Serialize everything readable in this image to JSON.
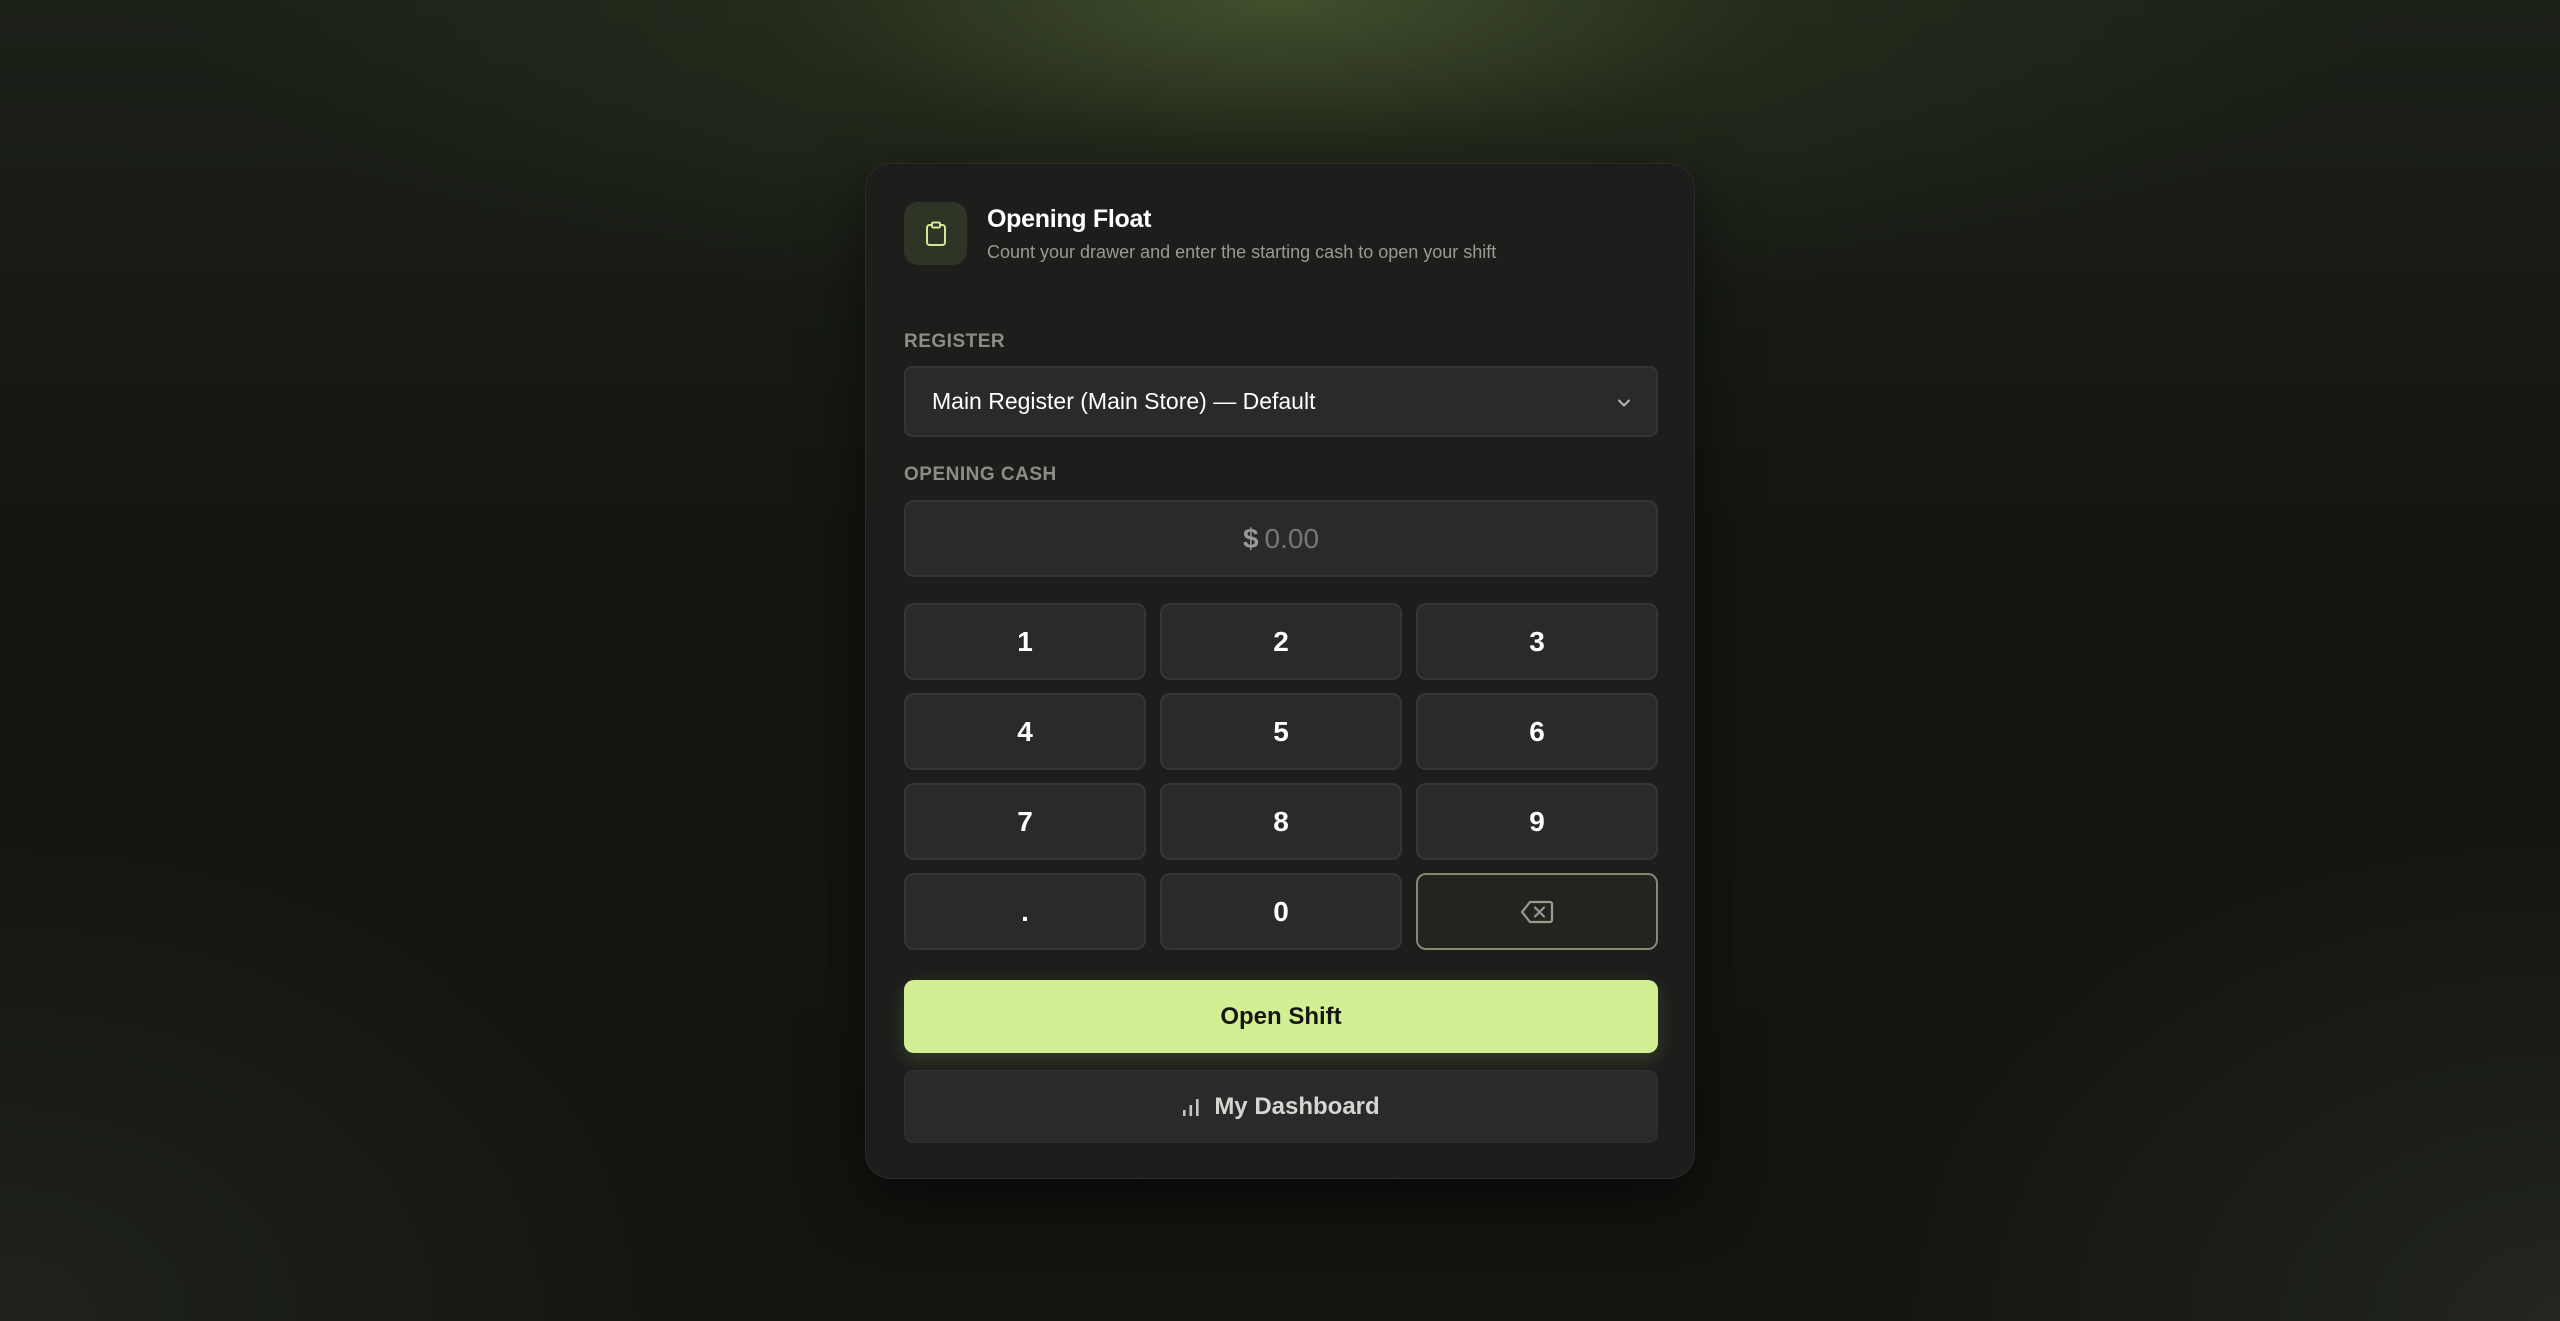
{
  "header": {
    "icon": "clipboard-icon",
    "title": "Opening Float",
    "subtitle": "Count your drawer and enter the starting cash to open your shift"
  },
  "register": {
    "label": "REGISTER",
    "selected": "Main Register (Main Store) — Default",
    "chevron_icon": "chevron-down-icon"
  },
  "opening_cash": {
    "label": "OPENING CASH",
    "currency": "$",
    "placeholder": "0.00"
  },
  "keypad": {
    "keys": [
      "1",
      "2",
      "3",
      "4",
      "5",
      "6",
      "7",
      "8",
      "9",
      ".",
      "0"
    ],
    "backspace_icon": "backspace-icon"
  },
  "actions": {
    "open_shift": "Open Shift",
    "dashboard": "My Dashboard",
    "dashboard_icon": "bar-chart-icon"
  },
  "colors": {
    "accent": "#d3ef93",
    "card_bg": "#1d1d1c",
    "field_bg": "#2a2a2c"
  }
}
